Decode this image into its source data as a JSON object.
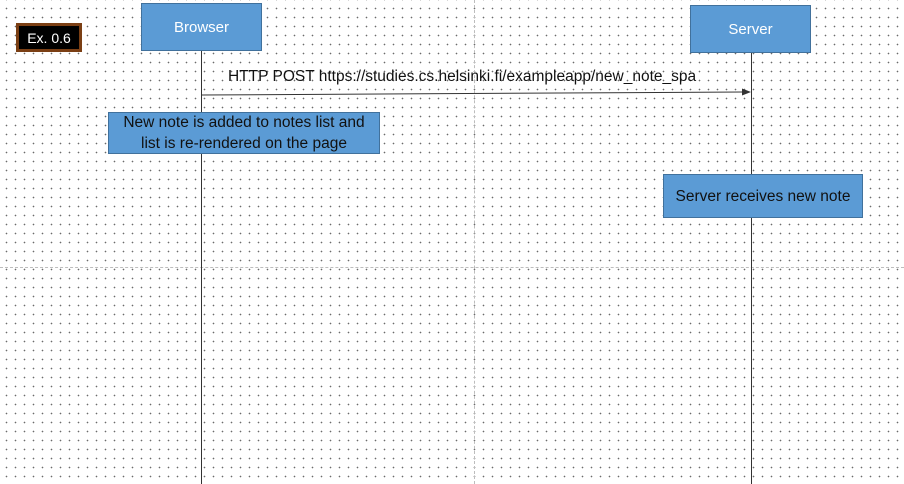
{
  "badge": {
    "label": "Ex. 0.6"
  },
  "actors": {
    "browser": "Browser",
    "server": "Server"
  },
  "message": {
    "label": "HTTP POST https://studies.cs.helsinki.fi/exampleapp/new_note_spa"
  },
  "notes": {
    "browser_line1": "New note is added to notes list and",
    "browser_line2": "list is re-rendered on the page",
    "server": "Server receives new note"
  },
  "colors": {
    "actor_fill": "#5b9bd5",
    "actor_border": "#41719c",
    "badge_fill": "#000000",
    "badge_border": "#7b3f14"
  }
}
